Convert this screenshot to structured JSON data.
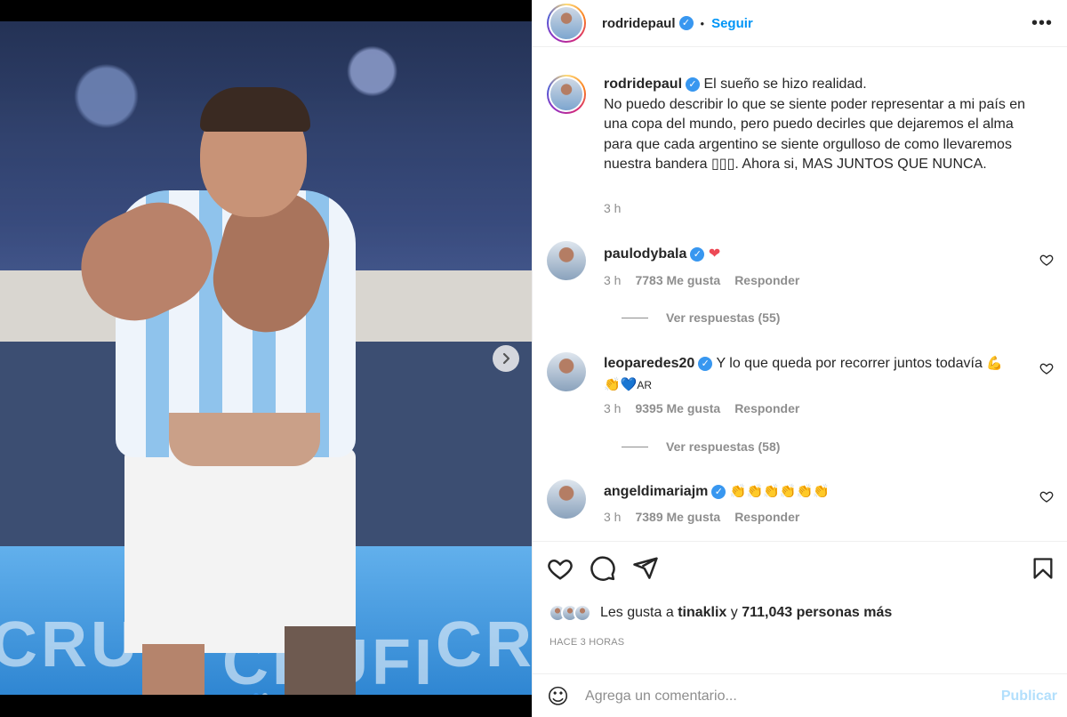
{
  "post": {
    "author": "rodridepaul",
    "follow_label": "Seguir",
    "dot_separator": "•",
    "more_label": "•••",
    "caption": {
      "username": "rodridepaul",
      "text_line1": "El sueño se hizo realidad.",
      "text_body": "No puedo describir lo que se siente poder representar a mi país en una copa del mundo, pero puedo decirles que dejaremos el alma para que cada argentino se siente orgulloso de como llevaremos nuestra bandera ▯▯▯. Ahora si, MAS JUNTOS QUE NUNCA.",
      "time": "3 h"
    },
    "media": {
      "next_icon": "chevron-right-icon",
      "board_text_left": "CRUF",
      "board_text_mid": "CRUFI",
      "board_text_right": "CRUF"
    }
  },
  "comments": [
    {
      "username": "paulodybala",
      "text": "",
      "emoji": "❤",
      "time": "3 h",
      "likes": "7783 Me gusta",
      "reply": "Responder",
      "replies": "Ver respuestas (55)"
    },
    {
      "username": "leoparedes20",
      "text": "Y lo que queda por recorrer juntos todavía",
      "emoji_line1": "💪",
      "emoji_line2": "👏💙",
      "flag": "AR",
      "time": "3 h",
      "likes": "9395 Me gusta",
      "reply": "Responder",
      "replies": "Ver respuestas (58)"
    },
    {
      "username": "angeldimariajm",
      "text": "",
      "emoji": "👏👏👏👏👏👏",
      "time": "3 h",
      "likes": "7389 Me gusta",
      "reply": "Responder"
    }
  ],
  "actions": {
    "likes_prefix": "Les gusta a",
    "likes_user": "tinaklix",
    "likes_conj": "y",
    "likes_count": "711,043 personas más",
    "time_ago": "HACE 3 HORAS"
  },
  "add_comment": {
    "placeholder": "Agrega un comentario...",
    "post_label": "Publicar",
    "emoji_icon": "☺"
  },
  "colors": {
    "link_blue": "#0095f6",
    "muted": "#8e8e8e",
    "verified": "#3897f0"
  }
}
